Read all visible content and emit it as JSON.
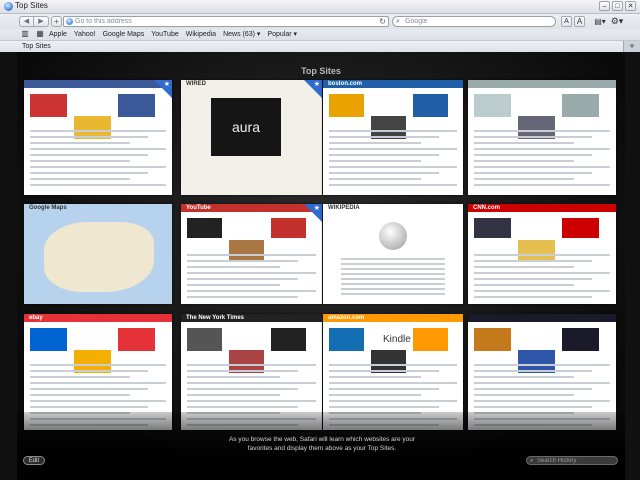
{
  "window": {
    "title": "Top Sites",
    "minimize": "–",
    "maximize": "□",
    "close": "✕"
  },
  "toolbar": {
    "back": "◀",
    "forward": "▶",
    "add": "+",
    "address_placeholder": "Go to this address",
    "reload": "↻",
    "search_placeholder": "Google",
    "font_smaller": "A",
    "font_larger": "A",
    "page_menu": "▤▾",
    "settings_menu": "⚙▾"
  },
  "bookmarks": {
    "items": [
      "Apple",
      "Yahoo!",
      "Google Maps",
      "YouTube",
      "Wikipedia",
      "News (63) ▾",
      "Popular ▾"
    ]
  },
  "tabs": {
    "active": "Top Sites",
    "new_tab": "+"
  },
  "top_sites": {
    "title": "Top Sites",
    "sites": [
      {
        "logo": "",
        "pinned": true
      },
      {
        "logo": "WIRED",
        "pinned": true,
        "hero": "aura"
      },
      {
        "logo": "boston.com",
        "pinned": false
      },
      {
        "logo": "",
        "pinned": false
      },
      {
        "logo": "Google Maps",
        "pinned": false
      },
      {
        "logo": "YouTube",
        "pinned": true
      },
      {
        "logo": "WIKIPEDIA",
        "pinned": false
      },
      {
        "logo": "CNN.com",
        "pinned": false
      },
      {
        "logo": "ebay",
        "pinned": false
      },
      {
        "logo": "The New York Times",
        "pinned": false
      },
      {
        "logo": "amazon.com",
        "pinned": false,
        "hero": "Kindle"
      },
      {
        "logo": "",
        "pinned": false
      }
    ],
    "info_text": "As you browse the web, Safari will learn which websites are your favorites and display them above as your Top Sites.",
    "edit_label": "Edit",
    "history_placeholder": "Search History"
  },
  "colors": {
    "accent_blue": "#2f6bd1",
    "background": "#0e0e0e"
  }
}
